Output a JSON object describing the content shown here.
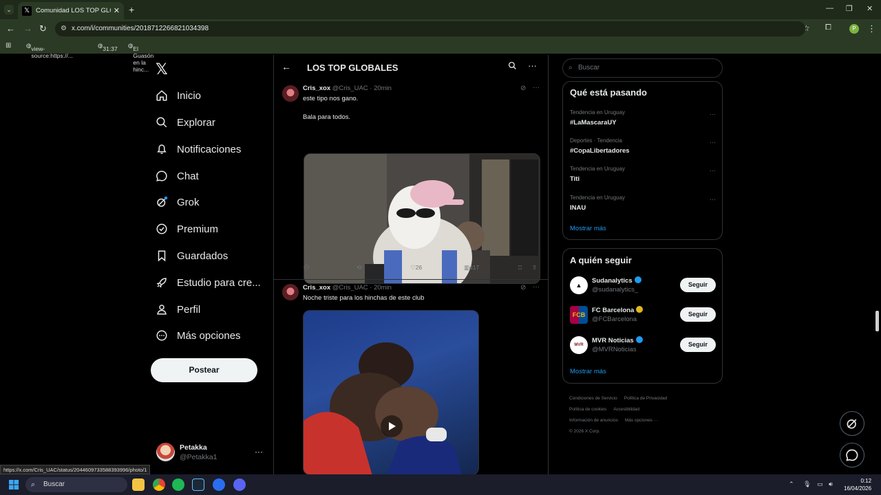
{
  "browser": {
    "tab_title": "Comunidad LOS TOP GLOBALES",
    "url": "x.com/i/communities/2018712266821034398",
    "bookmarks": [
      "view-source:https://...",
      "31:37",
      "El Guasón en la hinc..."
    ],
    "status_url": "https://x.com/Cris_UAC/status/2044609733588393996/photo/1"
  },
  "nav": {
    "items": [
      {
        "label": "Inicio",
        "icon": "home-icon"
      },
      {
        "label": "Explorar",
        "icon": "search-icon"
      },
      {
        "label": "Notificaciones",
        "icon": "bell-icon"
      },
      {
        "label": "Chat",
        "icon": "chat-icon"
      },
      {
        "label": "Grok",
        "icon": "grok-icon"
      },
      {
        "label": "Premium",
        "icon": "premium-icon"
      },
      {
        "label": "Guardados",
        "icon": "bookmark-icon"
      },
      {
        "label": "Estudio para cre...",
        "icon": "rocket-icon"
      },
      {
        "label": "Perfil",
        "icon": "person-icon"
      },
      {
        "label": "Más opciones",
        "icon": "more-circle-icon"
      }
    ],
    "post_label": "Postear",
    "profile": {
      "name": "Petakka",
      "handle": "@Petakka1"
    }
  },
  "main": {
    "title": "LOS TOP GLOBALES",
    "tweets": [
      {
        "name": "Cris_xox",
        "meta": "@Cris_UAC · 20min",
        "line1": "este tipo nos gano.",
        "line2": "Bala para todos.",
        "likes": "26",
        "views": "417"
      },
      {
        "name": "Cris_xox",
        "meta": "@Cris_UAC · 20min",
        "line1": "Noche triste para los hinchas de este club"
      }
    ]
  },
  "right": {
    "search_placeholder": "Buscar",
    "trends_title": "Qué está pasando",
    "trends": [
      {
        "category": "Tendencia en Uruguay",
        "name": "#LaMascaraUY"
      },
      {
        "category": "Deportes · Tendencia",
        "name": "#CopaLibertadores"
      },
      {
        "category": "Tendencia en Uruguay",
        "name": "Titi"
      },
      {
        "category": "Tendencia en Uruguay",
        "name": "INAU"
      }
    ],
    "show_more": "Mostrar más",
    "follow_title": "A quién seguir",
    "follow": [
      {
        "name": "Sudanalytics",
        "handle": "@sudanalytics_",
        "badge": "#1d9bf0"
      },
      {
        "name": "FC Barcelona",
        "handle": "@FCBarcelona",
        "badge": "#e2b719"
      },
      {
        "name": "MVR Noticias",
        "handle": "@MVRNoticias",
        "badge": "#1d9bf0"
      }
    ],
    "follow_btn": "Seguir",
    "footer": [
      "Condiciones de Servicio",
      "Política de Privacidad",
      "Política de cookies",
      "Accesibilidad",
      "Información de anuncios",
      "Más opciones ···",
      "© 2026 X Corp."
    ]
  },
  "taskbar": {
    "search": "Buscar",
    "time": "0:12",
    "date": "16/04/2026"
  }
}
